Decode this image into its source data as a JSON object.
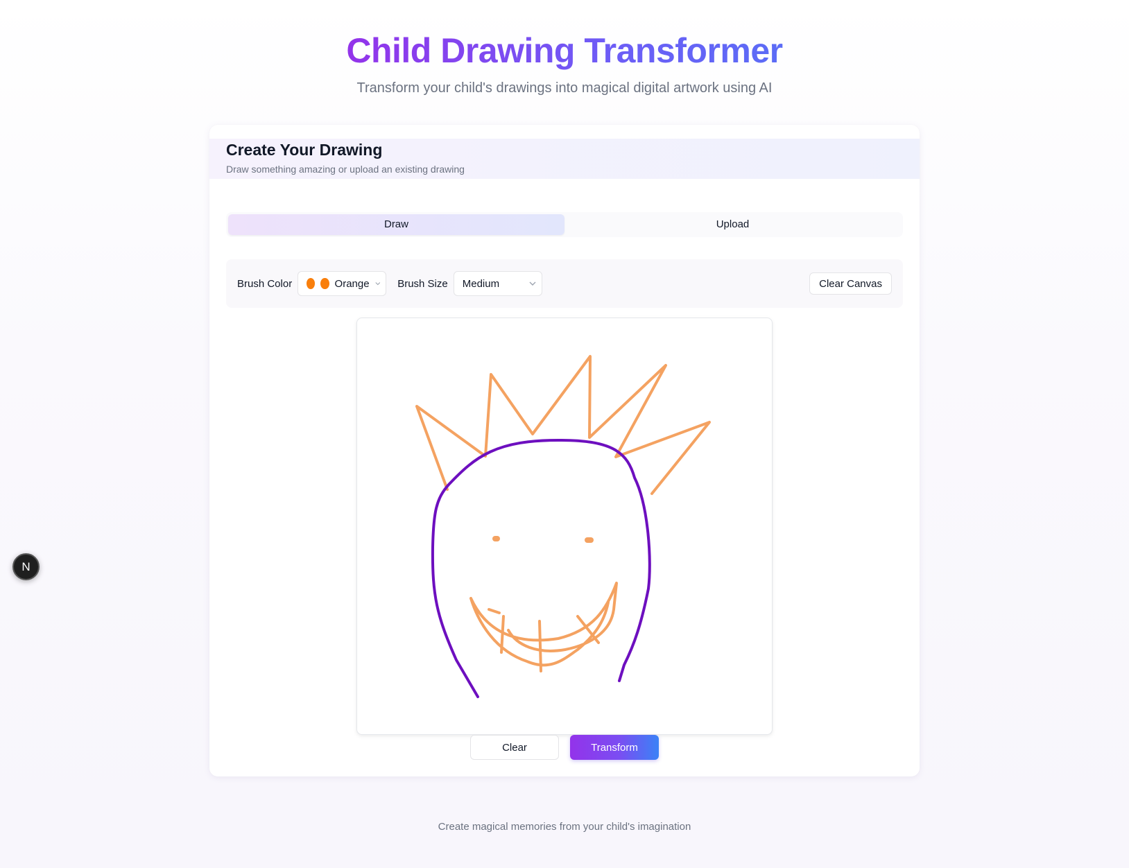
{
  "header": {
    "title": "Child Drawing Transformer",
    "subtitle": "Transform your child's drawings into magical digital artwork using AI"
  },
  "card": {
    "title": "Create Your Drawing",
    "description": "Draw something amazing or upload an existing drawing"
  },
  "tabs": [
    {
      "label": "Draw",
      "active": true
    },
    {
      "label": "Upload",
      "active": false
    }
  ],
  "toolbar": {
    "brush_color_label": "Brush Color",
    "brush_color_value": "Orange",
    "brush_color_hex": "#f97f0c",
    "brush_size_label": "Brush Size",
    "brush_size_value": "Medium",
    "clear_canvas_label": "Clear Canvas"
  },
  "drawing": {
    "orange_stroke": "#f4a261",
    "purple_stroke": "#6d0fbf"
  },
  "actions": {
    "clear_label": "Clear",
    "transform_label": "Transform"
  },
  "footer": {
    "text": "Create magical memories from your child's imagination"
  },
  "badge": {
    "letter": "N"
  }
}
